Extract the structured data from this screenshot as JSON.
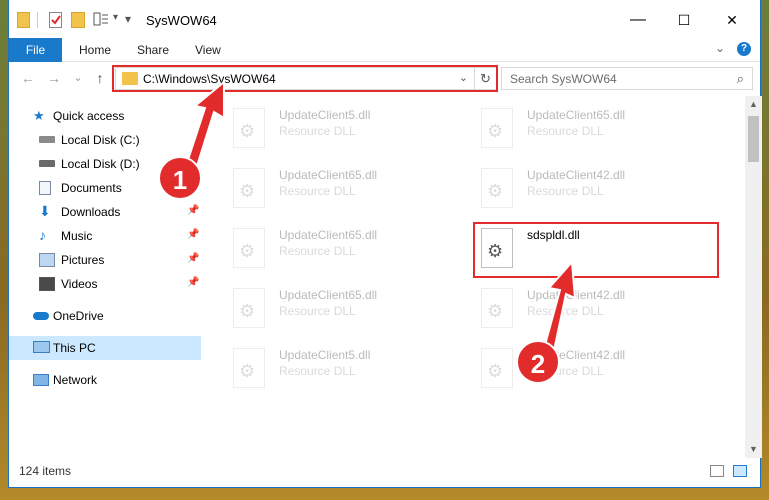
{
  "window": {
    "title": "SysWOW64",
    "controls": {
      "minimize": "—",
      "maximize": "☐",
      "close": "✕"
    }
  },
  "ribbon": {
    "tabs": [
      "File",
      "Home",
      "Share",
      "View"
    ],
    "help": "?"
  },
  "address": {
    "path": "C:\\Windows\\SysWOW64",
    "refresh": "↻",
    "search_placeholder": "Search SysWOW64"
  },
  "nav": {
    "back": "←",
    "forward": "→",
    "recent": "⌄",
    "up": "↑"
  },
  "sidebar": {
    "items": [
      {
        "label": "Quick access",
        "icon": "star-icon",
        "pinned": false
      },
      {
        "label": "Local Disk (C:)",
        "icon": "drive-icon",
        "pinned": false
      },
      {
        "label": "Local Disk (D:)",
        "icon": "drive-icon",
        "pinned": false
      },
      {
        "label": "Documents",
        "icon": "documents-icon",
        "pinned": true
      },
      {
        "label": "Downloads",
        "icon": "downloads-icon",
        "pinned": true
      },
      {
        "label": "Music",
        "icon": "music-icon",
        "pinned": true
      },
      {
        "label": "Pictures",
        "icon": "pictures-icon",
        "pinned": true
      },
      {
        "label": "Videos",
        "icon": "videos-icon",
        "pinned": true
      },
      {
        "label": "OneDrive",
        "icon": "onedrive-icon",
        "pinned": false
      },
      {
        "label": "This PC",
        "icon": "pc-icon",
        "pinned": false,
        "selected": true
      },
      {
        "label": "Network",
        "icon": "network-icon",
        "pinned": false
      }
    ]
  },
  "files": [
    {
      "name": "UpdateClient5.dll",
      "type": "Resource DLL",
      "faded": true
    },
    {
      "name": "UpdateClient65.dll",
      "type": "Resource DLL",
      "faded": true
    },
    {
      "name": "UpdateClient65.dll",
      "type": "Resource DLL",
      "faded": true
    },
    {
      "name": "UpdateClient42.dll",
      "type": "Resource DLL",
      "faded": true
    },
    {
      "name": "UpdateClient65.dll",
      "type": "Resource DLL",
      "faded": true
    },
    {
      "name": "sdspldl.dll",
      "type": "",
      "faded": false
    },
    {
      "name": "UpdateClient65.dll",
      "type": "Resource DLL",
      "faded": true
    },
    {
      "name": "UpdateClient42.dll",
      "type": "Resource DLL",
      "faded": true
    },
    {
      "name": "UpdateClient5.dll",
      "type": "Resource DLL",
      "faded": true
    },
    {
      "name": "UpdateClient42.dll",
      "type": "Resource DLL",
      "faded": true
    }
  ],
  "status": {
    "item_count": "124 items"
  },
  "annotations": {
    "step1": "1",
    "step2": "2",
    "highlight_color": "#e22b2b"
  },
  "colors": {
    "accent": "#1979ca",
    "selection": "#cce8ff",
    "folder": "#f3c44c"
  }
}
